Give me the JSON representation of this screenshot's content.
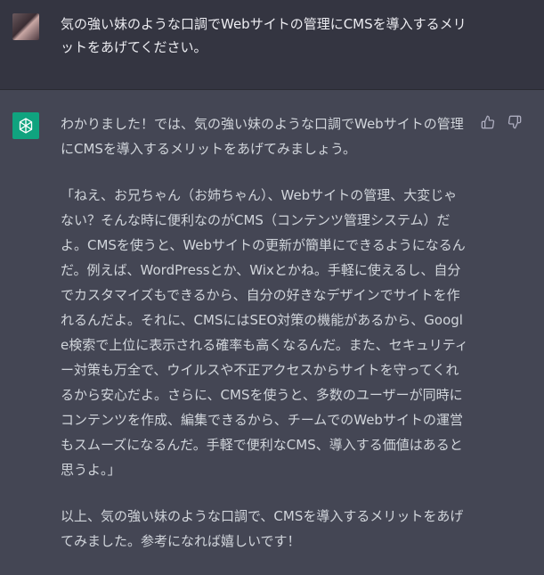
{
  "user": {
    "message": "気の強い妹のような口調でWebサイトの管理にCMSを導入するメリットをあげてください。",
    "avatar_icon": "user-photo-avatar"
  },
  "assistant": {
    "logo_icon": "openai-logo-icon",
    "paragraphs": [
      "わかりました！では、気の強い妹のような口調でWebサイトの管理にCMSを導入するメリットをあげてみましょう。",
      "「ねえ、お兄ちゃん（お姉ちゃん）、Webサイトの管理、大変じゃない？そんな時に便利なのがCMS（コンテンツ管理システム）だよ。CMSを使うと、Webサイトの更新が簡単にできるようになるんだ。例えば、WordPressとか、Wixとかね。手軽に使えるし、自分でカスタマイズもできるから、自分の好きなデザインでサイトを作れるんだよ。それに、CMSにはSEO対策の機能があるから、Google検索で上位に表示される確率も高くなるんだ。また、セキュリティー対策も万全で、ウイルスや不正アクセスからサイトを守ってくれるから安心だよ。さらに、CMSを使うと、多数のユーザーが同時にコンテンツを作成、編集できるから、チームでのWebサイトの運営もスムーズになるんだ。手軽で便利なCMS、導入する価値はあると思うよ。」",
      "以上、気の強い妹のような口調で、CMSを導入するメリットをあげてみました。参考になれば嬉しいです！"
    ],
    "feedback_icons": [
      "thumbs-up-icon",
      "thumbs-down-icon"
    ]
  },
  "colors": {
    "user_bg": "#343541",
    "assistant_bg": "#444654",
    "logo_green": "#10a37f",
    "text": "#d1d5db"
  }
}
